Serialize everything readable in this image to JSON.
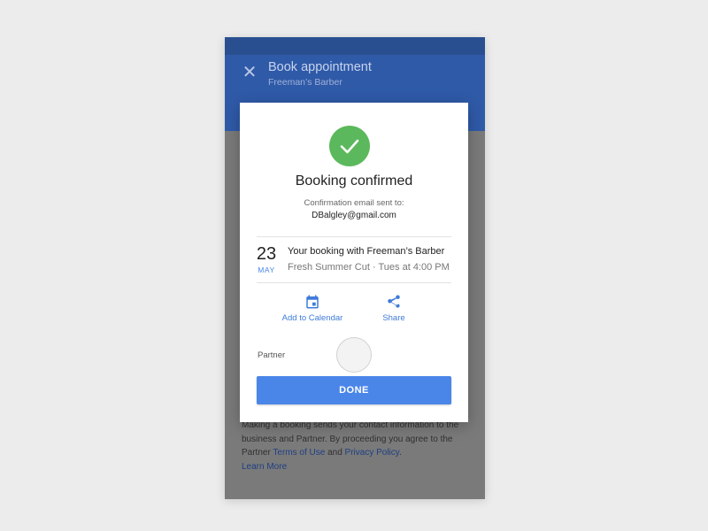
{
  "appbar": {
    "title": "Book appointment",
    "subtitle": "Freeman’s Barber",
    "close_icon": "close-icon"
  },
  "legal": {
    "text_before": "Making a booking sends your contact information to the business and Partner. By proceeding you agree to the Partner ",
    "terms_link": "Terms of Use",
    "and": " and ",
    "privacy_link": "Privacy Policy",
    "period": ".",
    "learn_more": "Learn More"
  },
  "dialog": {
    "icon": "check-icon",
    "heading": "Booking confirmed",
    "sent_label": "Confirmation email sent to:",
    "email": "DBalgley@gmail.com",
    "date": {
      "day": "23",
      "month": "MAY"
    },
    "booking_title": "Your booking with Freeman’s Barber",
    "booking_detail": "Fresh Summer Cut · Tues at 4:00 PM",
    "actions": [
      {
        "label": "Add to Calendar",
        "icon": "calendar-icon"
      },
      {
        "label": "Share",
        "icon": "share-icon"
      }
    ],
    "partner_label": "Partner",
    "done_label": "DONE"
  },
  "colors": {
    "accent": "#4a86e8",
    "success": "#5cb85c",
    "appbar": "#2f5aa8",
    "overlay": "#7a7a7a"
  }
}
